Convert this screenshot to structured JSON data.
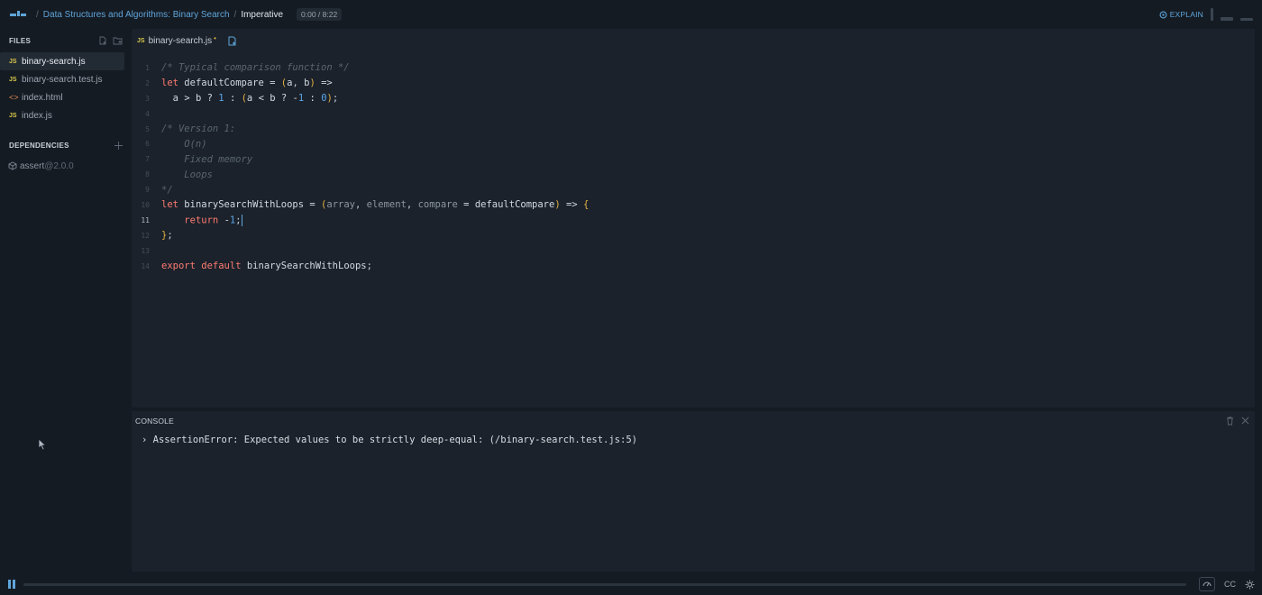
{
  "breadcrumb": {
    "course": "Data Structures and Algorithms: Binary Search",
    "lesson": "Imperative",
    "time": "0:00 / 8:22"
  },
  "header": {
    "explain_label": "EXPLAIN"
  },
  "sidebar": {
    "files_title": "FILES",
    "files": [
      {
        "name": "binary-search.js",
        "type": "js",
        "active": true
      },
      {
        "name": "binary-search.test.js",
        "type": "js"
      },
      {
        "name": "index.html",
        "type": "html"
      },
      {
        "name": "index.js",
        "type": "js"
      }
    ],
    "deps_title": "DEPENDENCIES",
    "dependencies": [
      {
        "name": "assert",
        "version": "@2.0.0"
      }
    ],
    "icon_labels": {
      "js": "JS",
      "html": "<>"
    }
  },
  "editor": {
    "tab_name": "binary-search.js",
    "dirty_mark": "•",
    "current_line": 11,
    "lines": [
      {
        "n": "1",
        "html": "<span class=\"cm\">/* Typical comparison function */</span>"
      },
      {
        "n": "2",
        "html": "<span class=\"kw\">let</span> <span class=\"id\">defaultCompare</span> <span class=\"op\">=</span> <span class=\"pr\">(</span><span class=\"id\">a</span>, <span class=\"id\">b</span><span class=\"pr\">)</span> <span class=\"op\">=&gt;</span>"
      },
      {
        "n": "3",
        "html": "  <span class=\"id\">a</span> <span class=\"op\">&gt;</span> <span class=\"id\">b</span> <span class=\"op\">?</span> <span class=\"num\">1</span> <span class=\"op\">:</span> <span class=\"pr\">(</span><span class=\"id\">a</span> <span class=\"op\">&lt;</span> <span class=\"id\">b</span> <span class=\"op\">?</span> <span class=\"op\">-</span><span class=\"num\">1</span> <span class=\"op\">:</span> <span class=\"num\">0</span><span class=\"pr\">)</span>;"
      },
      {
        "n": "4",
        "html": ""
      },
      {
        "n": "5",
        "html": "<span class=\"cm\">/* Version 1:</span>"
      },
      {
        "n": "6",
        "html": "<span class=\"cm\">    O(n)</span>"
      },
      {
        "n": "7",
        "html": "<span class=\"cm\">    Fixed memory</span>"
      },
      {
        "n": "8",
        "html": "<span class=\"cm\">    Loops</span>"
      },
      {
        "n": "9",
        "html": "<span class=\"cm\">*/</span>"
      },
      {
        "n": "10",
        "html": "<span class=\"kw\">let</span> <span class=\"id\">binarySearchWithLoops</span> <span class=\"op\">=</span> <span class=\"pr\">(</span><span class=\"prm\">array</span>, <span class=\"prm\">element</span>, <span class=\"prm\">compare</span> <span class=\"op\">=</span> <span class=\"id\">defaultCompare</span><span class=\"pr\">)</span> <span class=\"op\">=&gt;</span> <span class=\"pr\">{</span>"
      },
      {
        "n": "11",
        "html": "    <span class=\"kw\">return</span> <span class=\"op\">-</span><span class=\"num\">1</span>;<span class=\"caret\"></span>"
      },
      {
        "n": "12",
        "html": "<span class=\"pr\">}</span>;"
      },
      {
        "n": "13",
        "html": ""
      },
      {
        "n": "14",
        "html": "<span class=\"kw\">export</span> <span class=\"kw\">default</span> <span class=\"id\">binarySearchWithLoops</span>;"
      }
    ]
  },
  "console": {
    "title": "CONSOLE",
    "lines": [
      "› AssertionError: Expected values to be strictly deep-equal: (/binary-search.test.js:5)"
    ]
  },
  "player": {
    "cc_label": "CC",
    "progress": 0
  },
  "colors": {
    "accent": "#5fa5da",
    "background": "#151b23",
    "panel": "#1b222b"
  }
}
